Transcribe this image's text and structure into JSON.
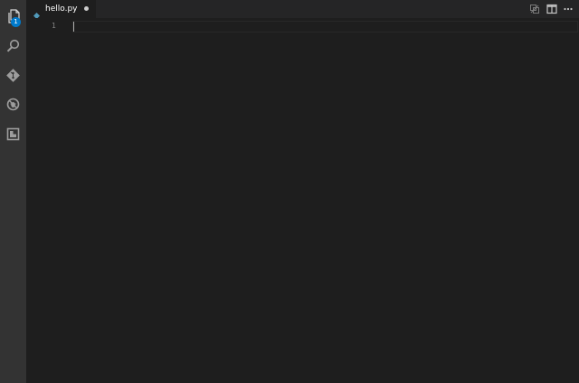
{
  "activity_bar": {
    "explorer_badge": "1",
    "items": [
      {
        "icon": "files-icon"
      },
      {
        "icon": "search-icon"
      },
      {
        "icon": "source-control-icon"
      },
      {
        "icon": "debug-icon"
      },
      {
        "icon": "extensions-icon"
      }
    ]
  },
  "tabs": [
    {
      "label": "hello.py",
      "icon": "python-file-icon",
      "dirty": true
    }
  ],
  "editor_actions": [
    {
      "icon": "open-changes-icon"
    },
    {
      "icon": "split-editor-icon"
    },
    {
      "icon": "more-actions-icon"
    }
  ],
  "editor": {
    "line_numbers": [
      "1"
    ]
  },
  "colors": {
    "activity_bar_bg": "#333333",
    "editor_bg": "#1e1e1e",
    "tab_strip_bg": "#252526",
    "badge": "#007acc",
    "python_icon": "#519aba"
  }
}
